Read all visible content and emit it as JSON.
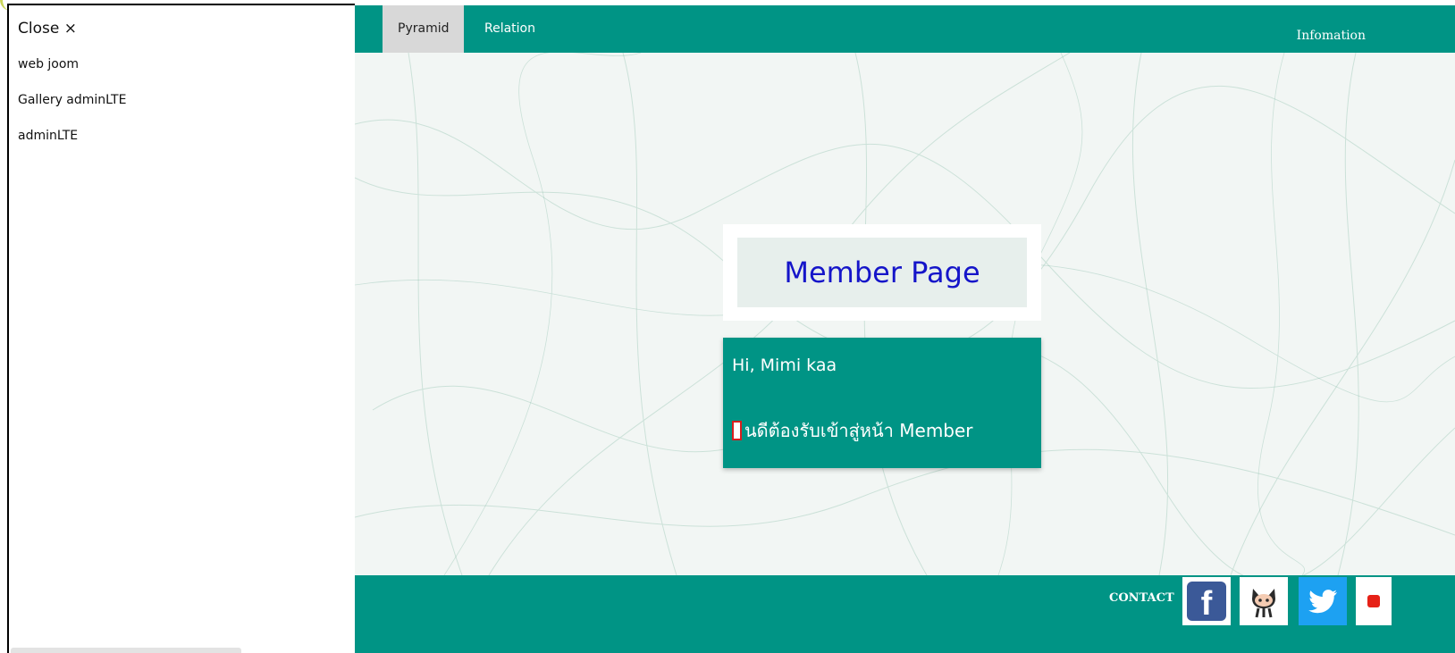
{
  "sidebar": {
    "close_label": "Close ×",
    "items": [
      {
        "label": "web joom"
      },
      {
        "label": "Gallery adminLTE"
      },
      {
        "label": "adminLTE"
      }
    ]
  },
  "topnav": {
    "tabs": [
      {
        "label": "Pyramid",
        "active": true
      },
      {
        "label": "Relation",
        "active": false
      }
    ],
    "info_label": "Infomation"
  },
  "main": {
    "title": "Member Page",
    "greeting": "Hi, Mimi kaa",
    "welcome_text": "นดีต้องรับเข้าสู่หน้า Member"
  },
  "footer": {
    "contact_label": "CONTACT",
    "social": [
      {
        "icon": "facebook-icon"
      },
      {
        "icon": "github-icon"
      },
      {
        "icon": "twitter-icon"
      },
      {
        "icon": "youtube-icon"
      }
    ]
  },
  "colors": {
    "accent": "#009485",
    "title_text": "#1515c9",
    "tab_active_bg": "#d8d8d8"
  }
}
